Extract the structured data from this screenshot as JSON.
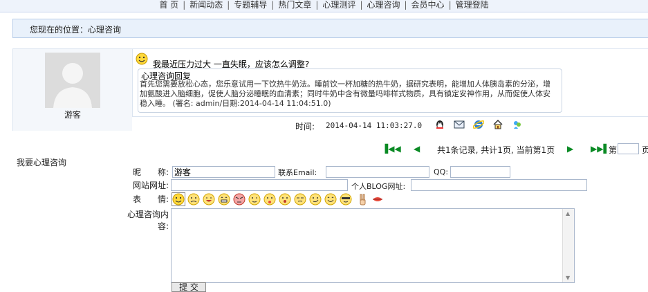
{
  "nav": {
    "items": [
      "首 页",
      "新闻动态",
      "专题辅导",
      "热门文章",
      "心理测评",
      "心理咨询",
      "会员中心",
      "管理登陆"
    ]
  },
  "breadcrumb": {
    "text": "您现在的位置：心理咨询"
  },
  "message": {
    "author": "游客",
    "title": "我最近压力过大 一直失眠，应该怎么调整?",
    "reply_heading": "心理咨询回复",
    "reply_text": "首先您需要放松心态，您乐意试用一下饮热牛奶法。睡前饮一杯加糖的热牛奶，据研究表明，能增加人体胰岛素的分泌，增加氨酸进入脑细胞，促使人脑分泌睡眠的血清素；同时牛奶中含有微量吗啡样式物质，具有镇定安神作用，从而促使人体安稳入睡。 (署名: admin/日期:2014-04-14 11:04:51.0)",
    "time_label": "时间:",
    "time_value": "2014-04-14 11:03:27.0",
    "icons": [
      "qq-icon",
      "email-icon",
      "ie-icon",
      "home-icon",
      "msn-icon"
    ]
  },
  "pager": {
    "text": "共1条记录, 共计1页, 当前第1页",
    "prefix": "第",
    "suffix": "页",
    "page_value": ""
  },
  "form": {
    "title": "我要心理咨询",
    "nickname_label": "昵　　称:",
    "nickname_value": "游客",
    "email_label": "联系Email:",
    "email_value": "",
    "qq_label": "QQ:",
    "qq_value": "",
    "website_label": "网站网址:",
    "website_value": "",
    "blog_label": "个人BLOG网址:",
    "blog_value": "",
    "emote_label": "表　　情:",
    "content_label": "心理咨询内容:",
    "content_value": "",
    "submit_label": "提 交"
  },
  "colors": {
    "nav_bg": "#eef3fb",
    "crumb_bg": "#e9f1fb",
    "pager_green": "#0a8a24",
    "border": "#a9b7cc"
  }
}
